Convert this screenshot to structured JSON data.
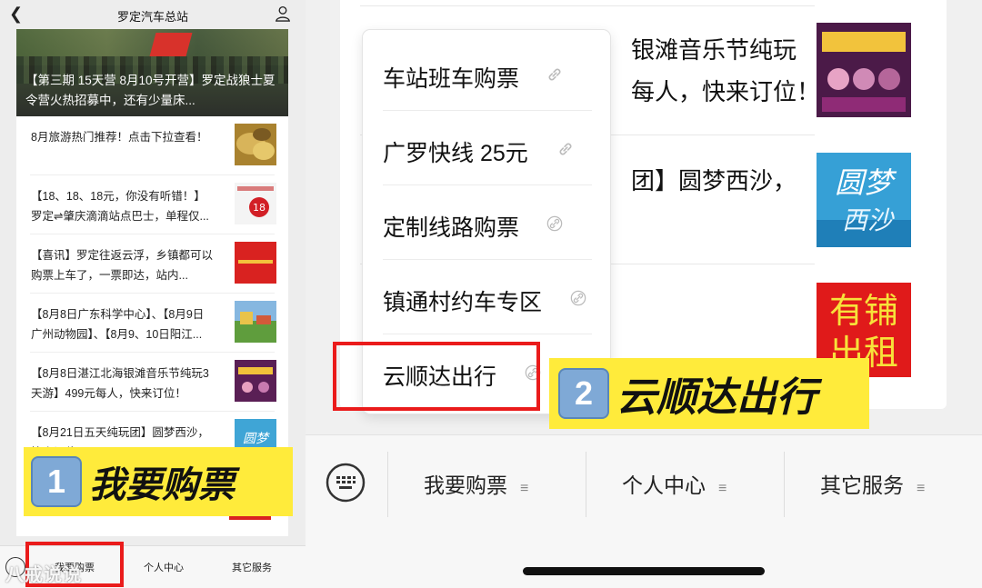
{
  "left": {
    "header": {
      "back_icon": "chevron-left-icon",
      "title": "罗定汽车总站",
      "user_icon": "user-icon"
    },
    "hero": {
      "caption": "【第三期 15天营 8月10号开营】罗定战狼士夏令营火热招募中，还有少量床..."
    },
    "articles": [
      {
        "text": "8月旅游热门推荐！点击下拉查看！",
        "thumb_color": "#c8a24a"
      },
      {
        "text": "【18、18、18元，你没有听错！】罗定⇌肇庆滴滴站点巴士，单程仅...",
        "thumb_color": "#f2f2f2",
        "thumb_badge": "18"
      },
      {
        "text": "【喜讯】罗定往返云浮，乡镇都可以购票上车了，一票即达，站内...",
        "thumb_color": "#d92220"
      },
      {
        "text": "【8月8日广东科学中心】、【8月9日广州动物园】、【8月9、10日阳江...",
        "thumb_color": "#6da04a"
      },
      {
        "text": "【8月8日湛江北海银滩音乐节纯玩3天游】499元每人，快来订位！",
        "thumb_color": "#7b2e6b"
      },
      {
        "text": "【8月21日五天纯玩团】圆梦西沙，快来订位！",
        "thumb_color": "#3fa5d6",
        "thumb_badge": "圆梦"
      }
    ],
    "step_label": {
      "number": "1",
      "text": "我要购票"
    },
    "bottom_menu": [
      "我要购票",
      "个人中心",
      "其它服务"
    ],
    "watermark": "八戒说说"
  },
  "right": {
    "background_texts": [
      "银滩音乐节纯玩",
      "每人，快来订位！",
      "团】圆梦西沙，"
    ],
    "popup_items": [
      "车站班车购票",
      "广罗快线 25元",
      "定制线路购票",
      "镇通村约车专区",
      "云顺达出行"
    ],
    "step_label": {
      "number": "2",
      "text": "云顺达出行"
    },
    "bottom_menu": [
      "我要购票",
      "个人中心",
      "其它服务"
    ],
    "thumb_texts": [
      "圆梦",
      "西沙",
      "有铺",
      "出租"
    ],
    "colors": {
      "highlight_red": "#ea1b1b",
      "label_yellow": "#ffeb3b"
    }
  }
}
